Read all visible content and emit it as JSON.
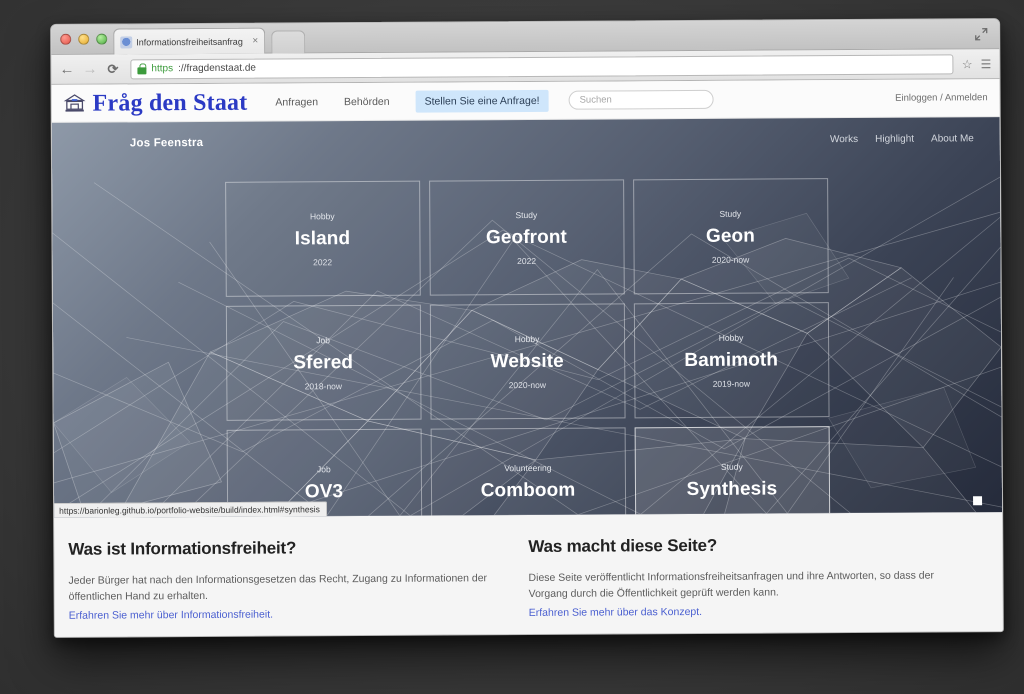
{
  "browser": {
    "tab_title": "Informationsfreiheitsanfrag",
    "tab_close": "×",
    "back_icon": "←",
    "forward_icon": "→",
    "reload_icon": "⟳",
    "url_scheme": "https",
    "url_rest": "://fragdenstaat.de",
    "star_icon": "☆",
    "menu_icon": "☰",
    "status_url": "https://barionleg.github.io/portfolio-website/build/index.html#synthesis"
  },
  "site_header": {
    "brand": "Fråg den Staat",
    "nav": [
      {
        "label": "Anfragen"
      },
      {
        "label": "Behörden"
      }
    ],
    "cta_label": "Stellen Sie eine Anfrage!",
    "search_placeholder": "Suchen",
    "account_label": "Einloggen / Anmelden",
    "cta_color": "#cfe6fb",
    "brand_color": "#2b3ac4"
  },
  "portfolio": {
    "name": "Jos Feenstra",
    "nav": [
      {
        "label": "Works"
      },
      {
        "label": "Highlight"
      },
      {
        "label": "About Me"
      }
    ],
    "cards": [
      {
        "category": "Hobby",
        "title": "Island",
        "year": "2022",
        "hovered": false
      },
      {
        "category": "Study",
        "title": "Geofront",
        "year": "2022",
        "hovered": false
      },
      {
        "category": "Study",
        "title": "Geon",
        "year": "2020-now",
        "hovered": false
      },
      {
        "category": "Job",
        "title": "Sfered",
        "year": "2018-now",
        "hovered": false
      },
      {
        "category": "Hobby",
        "title": "Website",
        "year": "2020-now",
        "hovered": false
      },
      {
        "category": "Hobby",
        "title": "Bamimoth",
        "year": "2019-now",
        "hovered": false
      },
      {
        "category": "Job",
        "title": "OV3",
        "year": "",
        "hovered": false
      },
      {
        "category": "Volunteering",
        "title": "Comboom",
        "year": "",
        "hovered": false
      },
      {
        "category": "Study",
        "title": "Synthesis",
        "year": "",
        "hovered": true
      }
    ]
  },
  "info": {
    "left": {
      "heading": "Was ist Informationsfreiheit?",
      "body": "Jeder Bürger hat nach den Informationsgesetzen das Recht, Zugang zu Informationen der öffentlichen Hand zu erhalten.",
      "link": "Erfahren Sie mehr über Informationsfreiheit."
    },
    "right": {
      "heading": "Was macht diese Seite?",
      "body": "Diese Seite veröffentlicht Informationsfreiheitsanfragen und ihre Antworten, so dass der Vorgang durch die Öffentlichkeit geprüft werden kann.",
      "link": "Erfahren Sie mehr über das Konzept."
    }
  }
}
